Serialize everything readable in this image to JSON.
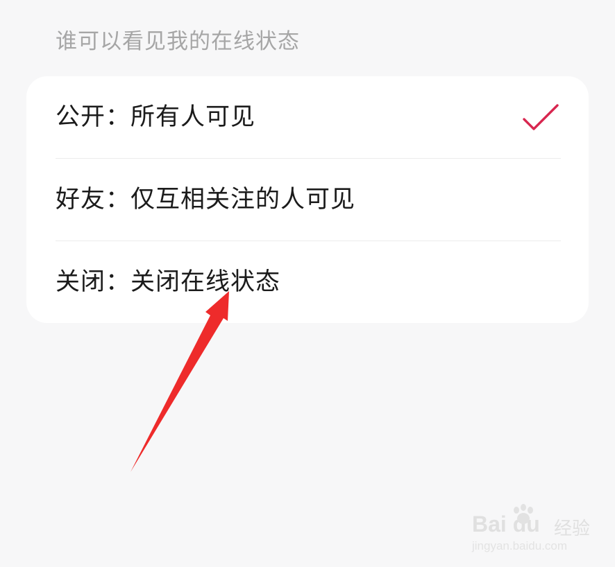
{
  "section": {
    "title": "谁可以看见我的在线状态"
  },
  "options": [
    {
      "label": "公开：所有人可见",
      "selected": true
    },
    {
      "label": "好友：仅互相关注的人可见",
      "selected": false
    },
    {
      "label": "关闭：关闭在线状态",
      "selected": false
    }
  ],
  "colors": {
    "check": "#d8264f",
    "arrow": "#ee2b2b",
    "title": "#a6a6a6",
    "text": "#1b1b1b"
  },
  "icons": {
    "selected": "checkmark-icon",
    "annotation": "red-arrow-annotation"
  },
  "watermark": {
    "brand": "Bai du",
    "product": "经验",
    "url": "jingyan.baidu.com"
  }
}
